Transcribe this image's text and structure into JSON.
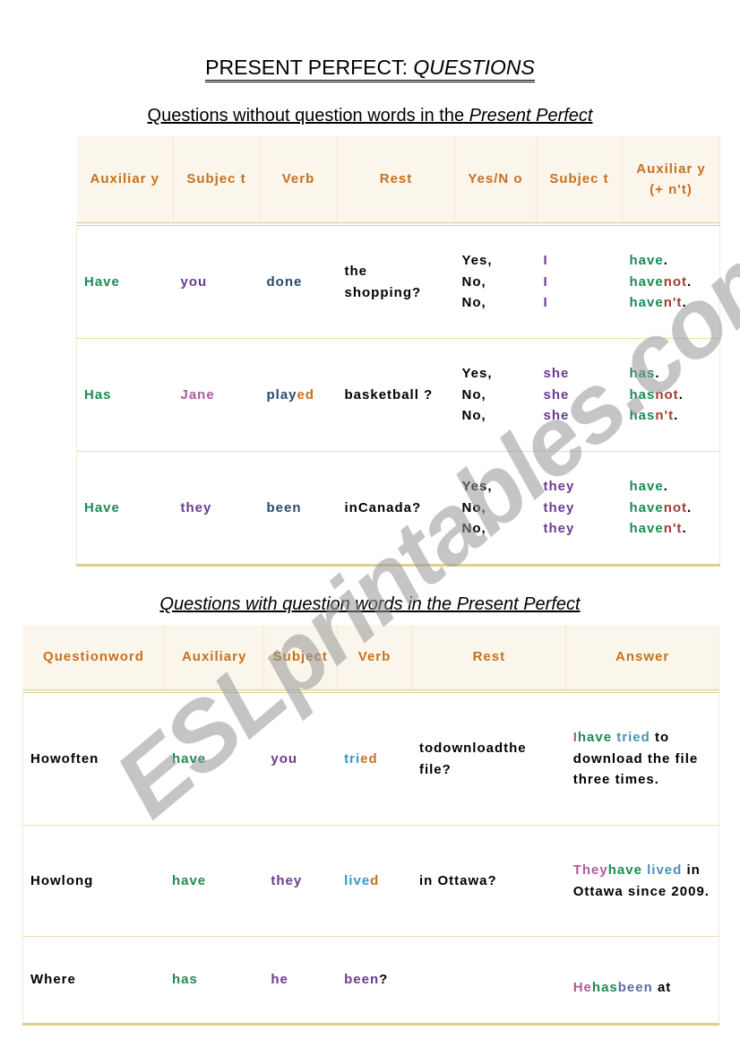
{
  "title": {
    "plain": "PRESENT PERFECT: ",
    "italic": "QUESTIONS"
  },
  "section1": {
    "heading_plain": "Questions without question words in the ",
    "heading_italic": "Present Perfect",
    "headers": [
      "Auxiliar y",
      "Subjec t",
      "Verb",
      "Rest",
      "Yes/N o",
      "Subjec t",
      "Auxiliar y (+ n't)"
    ],
    "rows": [
      {
        "aux": "Have",
        "subject": "you",
        "verb": "done",
        "verb_ending": "",
        "rest": "the shopping?",
        "yesno": [
          "Yes,",
          "No,",
          "No,"
        ],
        "subj2": [
          "I",
          "I",
          "I"
        ],
        "ans": [
          {
            "base": "have",
            "neg": "",
            "end": "."
          },
          {
            "base": "have",
            "neg": "not",
            "end": "."
          },
          {
            "base": "have",
            "neg": "n't",
            "end": "."
          }
        ]
      },
      {
        "aux": "Has",
        "subject": "Jane",
        "verb": "play",
        "verb_ending": "ed",
        "rest": "basketball ?",
        "yesno": [
          "Yes,",
          "No,",
          "No,"
        ],
        "subj2": [
          "she",
          "she",
          "she"
        ],
        "ans": [
          {
            "base": "has",
            "neg": "",
            "end": "."
          },
          {
            "base": "has",
            "neg": "not",
            "end": "."
          },
          {
            "base": "has",
            "neg": "n't",
            "end": "."
          }
        ]
      },
      {
        "aux": "Have",
        "subject": "they",
        "verb": "been",
        "verb_ending": "",
        "rest": "inCanada?",
        "yesno": [
          "Yes,",
          "No,",
          "No,"
        ],
        "subj2": [
          "they",
          "they",
          "they"
        ],
        "ans": [
          {
            "base": "have",
            "neg": "",
            "end": "."
          },
          {
            "base": "have",
            "neg": "not",
            "end": "."
          },
          {
            "base": "have",
            "neg": "n't",
            "end": "."
          }
        ]
      }
    ]
  },
  "section2": {
    "heading": "Questions with question words in the Present Perfect",
    "headers": [
      "Questionword",
      "Auxiliary",
      "Subject",
      "Verb",
      "Rest",
      "Answer"
    ],
    "rows": [
      {
        "qword": "Howoften",
        "aux": "have",
        "subject": "you",
        "verb_stem": "tri",
        "verb_ending": "ed",
        "rest": "todownloadthe file?",
        "answer": {
          "subj": "I",
          "aux": "have",
          "verb": "tried",
          "tail": " to download the file three times."
        }
      },
      {
        "qword": "Howlong",
        "aux": "have",
        "subject": "they",
        "verb_stem": "live",
        "verb_ending": "d",
        "rest": "in Ottawa?",
        "answer": {
          "subj": "They",
          "aux": "have",
          "verb": "lived",
          "tail": " in Ottawa since 2009."
        }
      },
      {
        "qword": "Where",
        "aux": "has",
        "subject": "he",
        "verb_stem": "been",
        "verb_ending": "?",
        "rest": "",
        "answer": {
          "subj": "He",
          "aux": "has",
          "verb": "been",
          "tail": " at"
        }
      }
    ]
  },
  "watermark": "ESLprintables.com",
  "colors": {
    "header_text": "#c8701e",
    "auxiliary": "#1d8a54",
    "subject": "#6b3a8f",
    "verb": "#26496b",
    "negation": "#a33a2e",
    "verb_cyan": "#2d9bc7"
  }
}
